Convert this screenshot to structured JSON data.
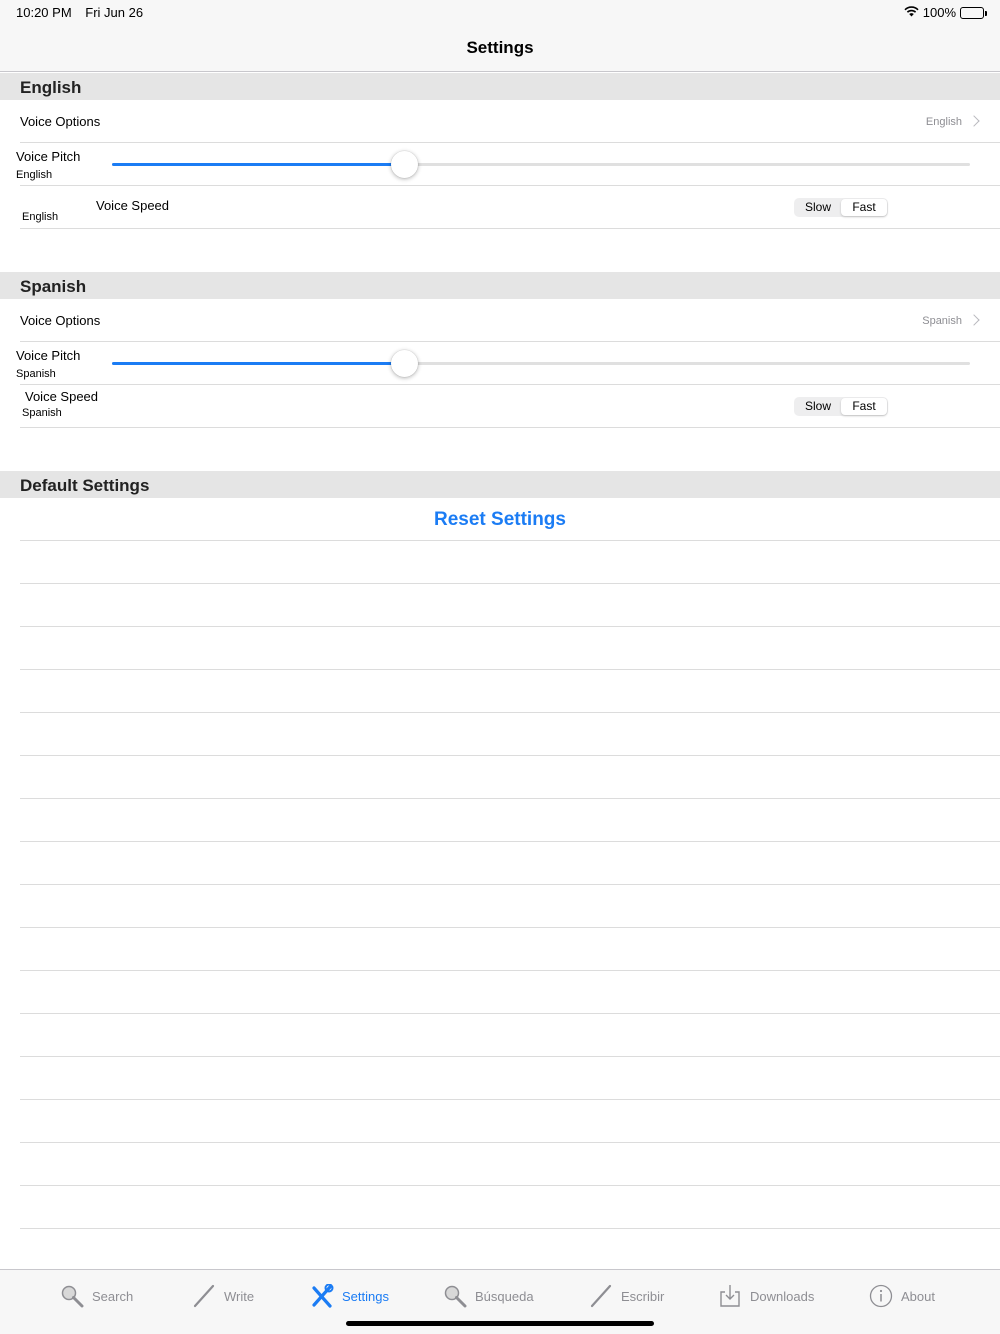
{
  "status": {
    "time": "10:20 PM",
    "date": "Fri Jun 26",
    "battery": "100%",
    "icons": [
      "wifi-icon",
      "battery-icon"
    ]
  },
  "nav": {
    "title": "Settings"
  },
  "english": {
    "header": "English",
    "voice_options_label": "Voice Options",
    "voice_options_value": "English",
    "pitch_label": "Voice Pitch",
    "pitch_sublabel": "English",
    "pitch_value": 0.34,
    "speed_label": "Voice Speed",
    "speed_sublabel": "English",
    "speed_options": [
      "Slow",
      "Fast"
    ],
    "speed_selected": "Fast"
  },
  "spanish": {
    "header": "Spanish",
    "voice_options_label": "Voice Options",
    "voice_options_value": "Spanish",
    "pitch_label": "Voice Pitch",
    "pitch_sublabel": "Spanish",
    "pitch_value": 0.34,
    "speed_label": "Voice Speed",
    "speed_sublabel": "Spanish",
    "speed_options": [
      "Slow",
      "Fast"
    ],
    "speed_selected": "Fast"
  },
  "defaults": {
    "header": "Default Settings",
    "reset_label": "Reset Settings"
  },
  "tabs": [
    {
      "label": "Search",
      "icon": "magnifier-icon",
      "active": false
    },
    {
      "label": "Write",
      "icon": "pencil-icon",
      "active": false
    },
    {
      "label": "Settings",
      "icon": "tools-icon",
      "active": true
    },
    {
      "label": "Búsqueda",
      "icon": "magnifier-icon",
      "active": false
    },
    {
      "label": "Escribir",
      "icon": "pencil-icon",
      "active": false
    },
    {
      "label": "Downloads",
      "icon": "download-icon",
      "active": false
    },
    {
      "label": "About",
      "icon": "info-icon",
      "active": false
    }
  ],
  "colors": {
    "accent": "#1b7cf4",
    "header_bg": "#e5e5e5",
    "bar_bg": "#f7f7f7"
  }
}
